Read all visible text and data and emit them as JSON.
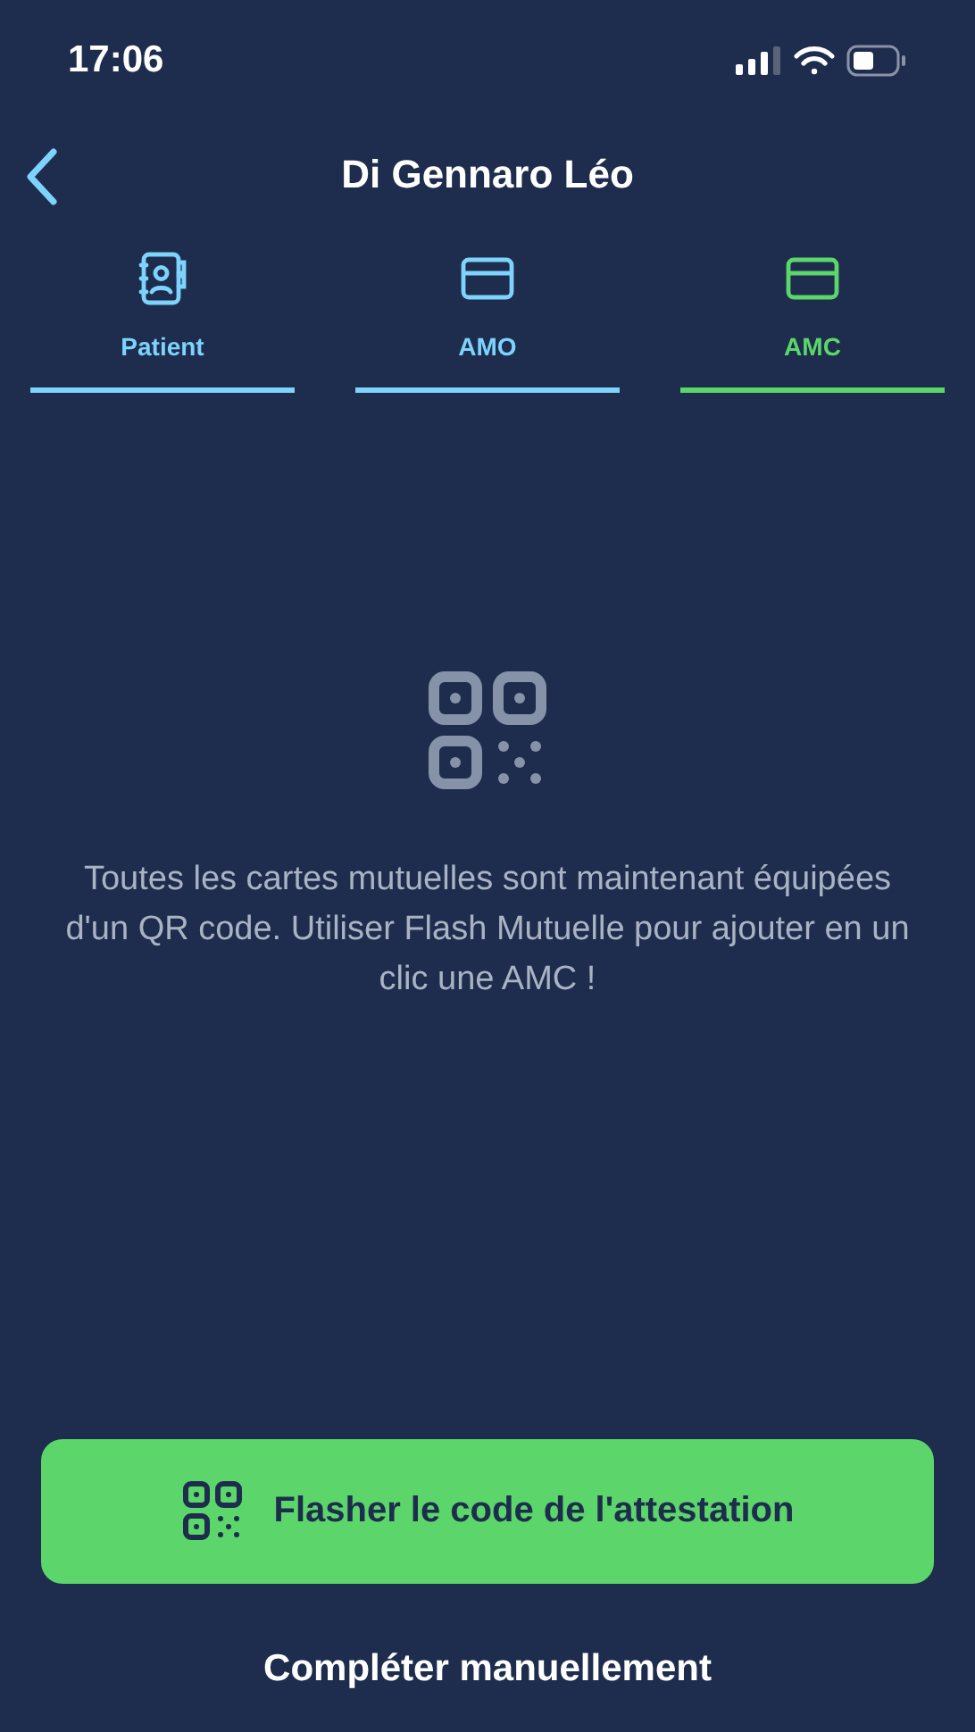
{
  "status_bar": {
    "time": "17:06"
  },
  "header": {
    "title": "Di Gennaro Léo"
  },
  "tabs": [
    {
      "label": "Patient",
      "kind": "contact",
      "selected": false
    },
    {
      "label": "AMO",
      "kind": "card",
      "selected": false
    },
    {
      "label": "AMC",
      "kind": "card",
      "selected": true
    }
  ],
  "empty_state": {
    "message": "Toutes les cartes mutuelles sont maintenant équipées d'un QR code. Utiliser Flash Mutuelle pour ajouter en un clic une AMC !"
  },
  "primary_button": {
    "label": "Flasher le code de l'attestation"
  },
  "secondary_button": {
    "label": "Compléter manuellement"
  }
}
